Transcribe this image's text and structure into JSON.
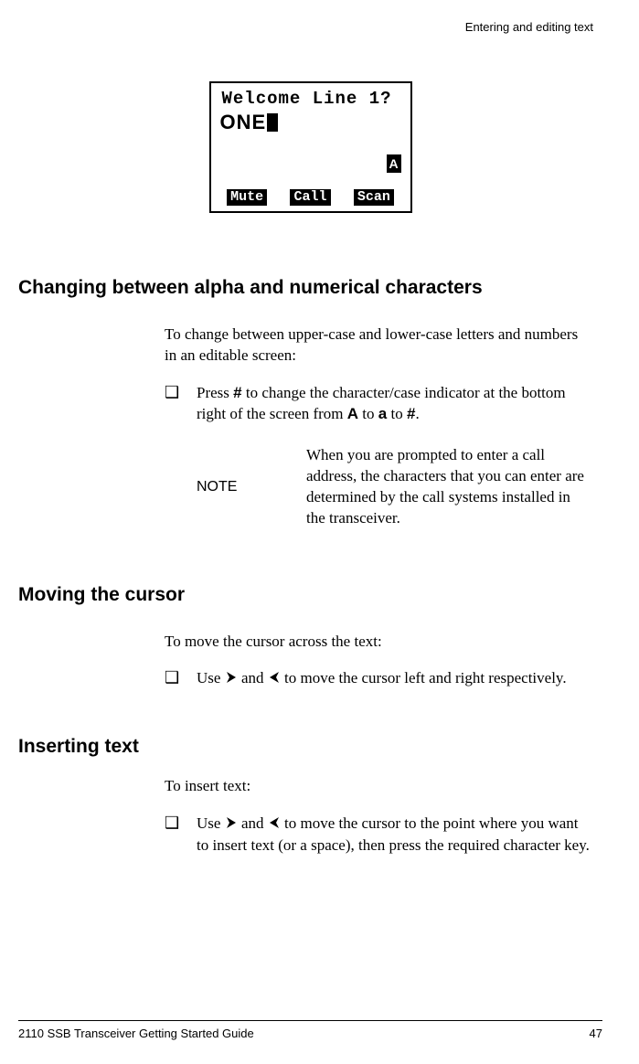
{
  "runningHead": "Entering and editing text",
  "lcd": {
    "title": "Welcome Line 1?",
    "entry": "ONE",
    "modeIndicator": "A",
    "softkeys": [
      "Mute",
      "Call",
      "Scan"
    ]
  },
  "section1": {
    "heading": "Changing between alpha and numerical characters",
    "intro": "To change between upper-case and lower-case letters and numbers in an editable screen:",
    "step": {
      "before": "Press ",
      "key": "#",
      "mid": " to change the character/case indicator at the bottom right of the screen from ",
      "a1": "A",
      "mid2": " to ",
      "a2": "a",
      "mid3": " to ",
      "a3": "#",
      "end": "."
    },
    "noteLabel": "NOTE",
    "noteBody": "When you are prompted to enter a call address, the characters that you can enter are determined by the call systems installed in the transceiver."
  },
  "section2": {
    "heading": "Moving the cursor",
    "intro": "To move the cursor across the text:",
    "stepBefore": "Use ",
    "stepMid": " and ",
    "stepAfter": " to move the cursor left and right respectively."
  },
  "section3": {
    "heading": "Inserting text",
    "intro": "To insert text:",
    "stepBefore": "Use ",
    "stepMid": " and ",
    "stepAfter": " to move the cursor to the point where you want to insert text (or a space), then press the required character key."
  },
  "footer": {
    "title": "2110 SSB Transceiver Getting Started Guide",
    "page": "47"
  },
  "bullet": "❑"
}
